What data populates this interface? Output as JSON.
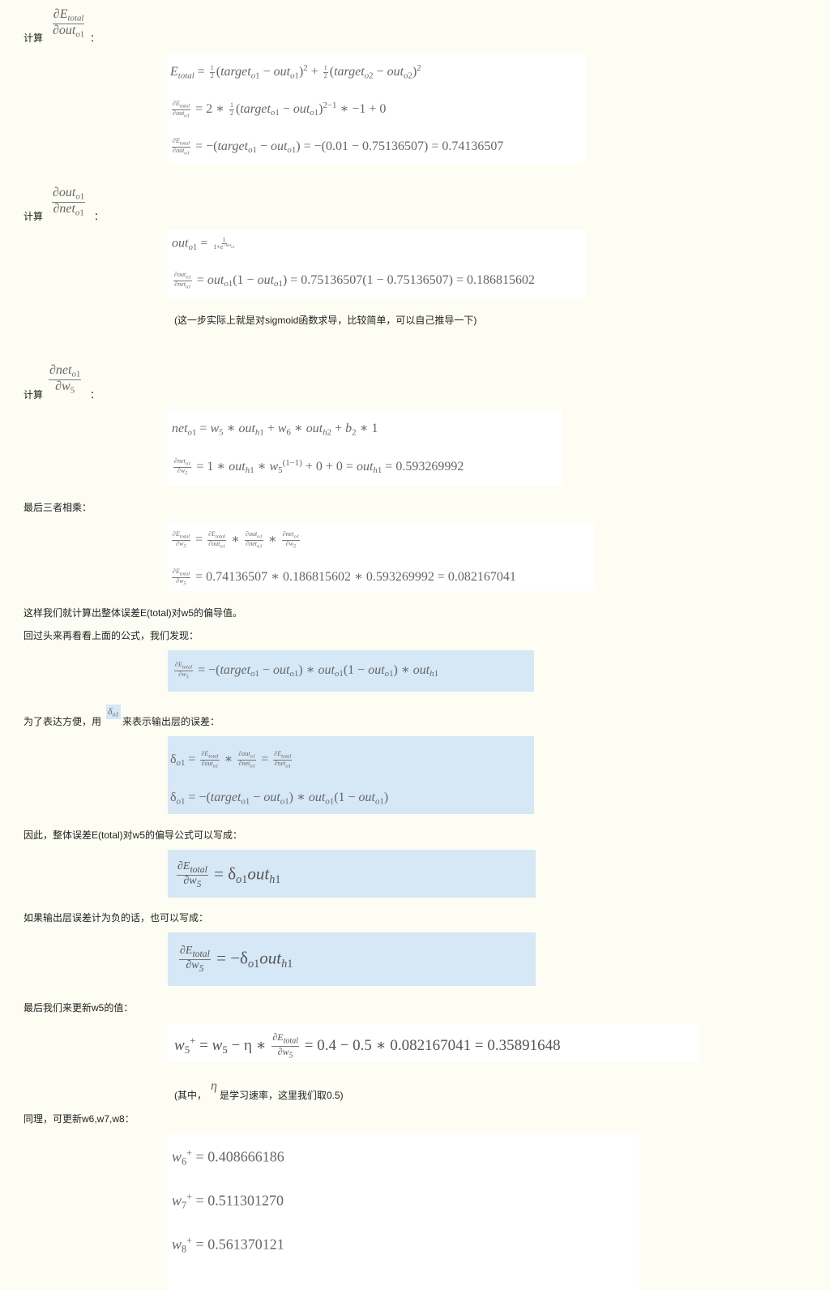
{
  "labels": {
    "compute": "计算",
    "colon": "：",
    "sigmoid_note": "(这一步实际上就是对sigmoid函数求导，比较简单，可以自己推导一下)",
    "multiply_three": "最后三者相乘：",
    "computed_partial": "这样我们就计算出整体误差E(total)对w5的偏导值。",
    "look_back": "回过头来再看看上面的公式，我们发现：",
    "for_convenience_1": "为了表达方便，用",
    "for_convenience_2": "来表示输出层的误差：",
    "therefore": "因此，整体误差E(total)对w5的偏导公式可以写成：",
    "if_negative": "如果输出层误差计为负的话，也可以写成：",
    "update_w5": "最后我们来更新w5的值：",
    "eta_note_1": "(其中，",
    "eta_note_2": "是学习速率，这里我们取0.5)",
    "likewise": "同理，可更新w6,w7,w8："
  },
  "numbers": {
    "target_o1": "0.01",
    "out_o1": "0.75136507",
    "dE_dout": "0.74136507",
    "dout_dnet": "0.186815602",
    "out_h1": "0.593269992",
    "dE_dw5": "0.082167041",
    "w5_old": "0.4",
    "eta": "0.5",
    "w5_new": "0.35891648",
    "w6_new": "0.408666186",
    "w7_new": "0.511301270",
    "w8_new": "0.561370121"
  }
}
